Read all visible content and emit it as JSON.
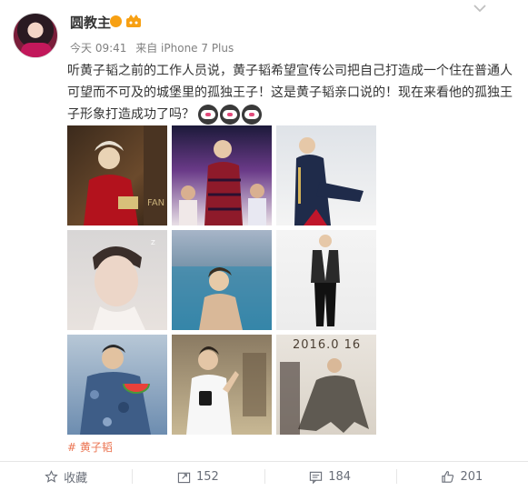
{
  "post": {
    "username": "圆教主",
    "meta": {
      "time": "今天 09:41",
      "source": "来自 iPhone 7 Plus"
    },
    "text": "听黄子韬之前的工作人员说，黄子韬希望宣传公司把自己打造成一个住在普通人可望而不可及的城堡里的孤独王子！这是黄子韬亲口说的！现在来看他的孤独王子形象打造成功了吗？",
    "emojis": [
      "doge-emoji",
      "doge-emoji",
      "doge-emoji"
    ],
    "photo_overlays": {
      "photo1": "FAN",
      "photo9": "2016.0  16"
    },
    "tag": "# 黄子韬"
  },
  "actions": {
    "favorite_label": "收藏",
    "repost_count": "152",
    "comment_count": "184",
    "like_count": "201"
  },
  "colors": {
    "link": "#eb7350",
    "badge": "#f7a013",
    "text": "#333333",
    "muted": "#808080"
  }
}
